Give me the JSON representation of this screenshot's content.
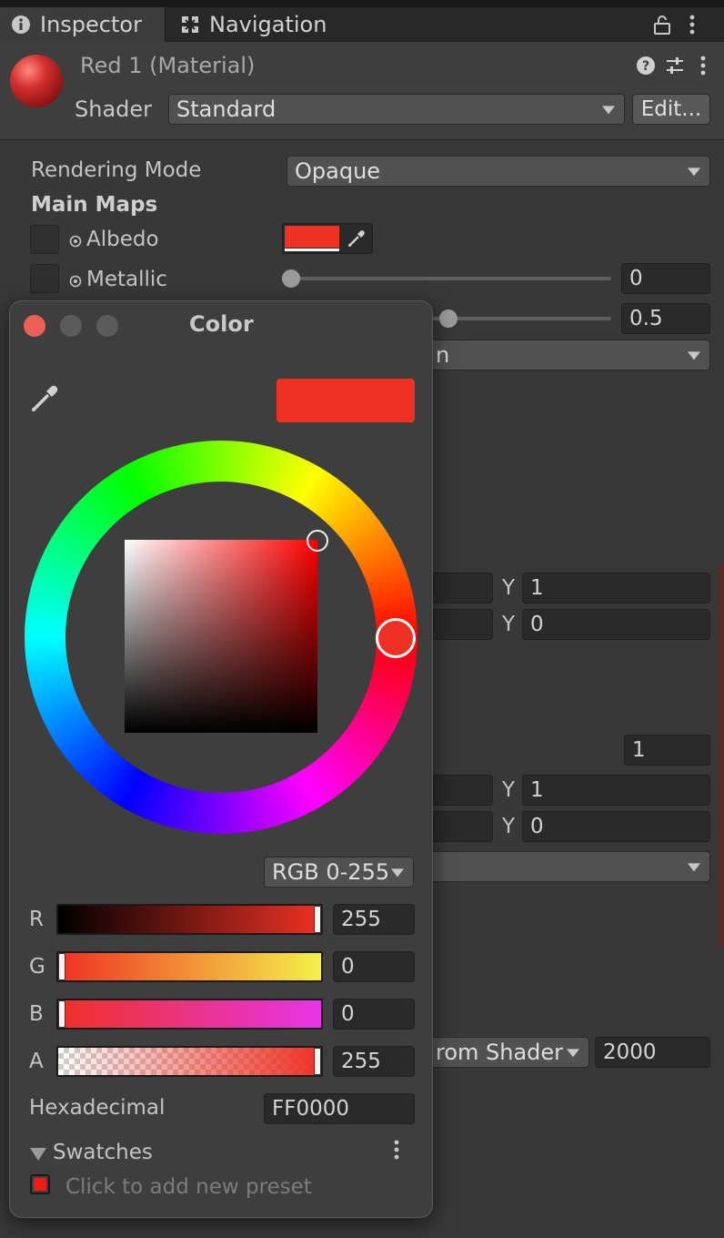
{
  "tabs": {
    "inspector": "Inspector",
    "navigation": "Navigation"
  },
  "header": {
    "material_title": "Red 1 (Material)",
    "shader_label": "Shader",
    "shader_value": "Standard",
    "edit_button": "Edit..."
  },
  "inspector": {
    "rendering_mode_label": "Rendering Mode",
    "rendering_mode_value": "Opaque",
    "main_maps_label": "Main Maps",
    "albedo_label": "Albedo",
    "metallic_label": "Metallic",
    "metallic_value": "0",
    "smoothness_value": "0.5",
    "source_partial": "n",
    "y_label": "Y",
    "tiling_y": "1",
    "offset_y": "0",
    "detail_value": "1",
    "tiling2_y": "1",
    "offset2_y": "0",
    "render_queue_partial": "rom Shader",
    "render_queue_value": "2000",
    "albedo_color": "#ef3124"
  },
  "color_picker": {
    "title": "Color",
    "mode": "RGB 0-255",
    "channels": {
      "r_label": "R",
      "r_value": "255",
      "g_label": "G",
      "g_value": "0",
      "b_label": "B",
      "b_value": "0",
      "a_label": "A",
      "a_value": "255"
    },
    "hex_label": "Hexadecimal",
    "hex_value": "FF0000",
    "swatches_label": "Swatches",
    "add_preset_text": "Click to add new preset",
    "preview_color": "#ef3124"
  }
}
